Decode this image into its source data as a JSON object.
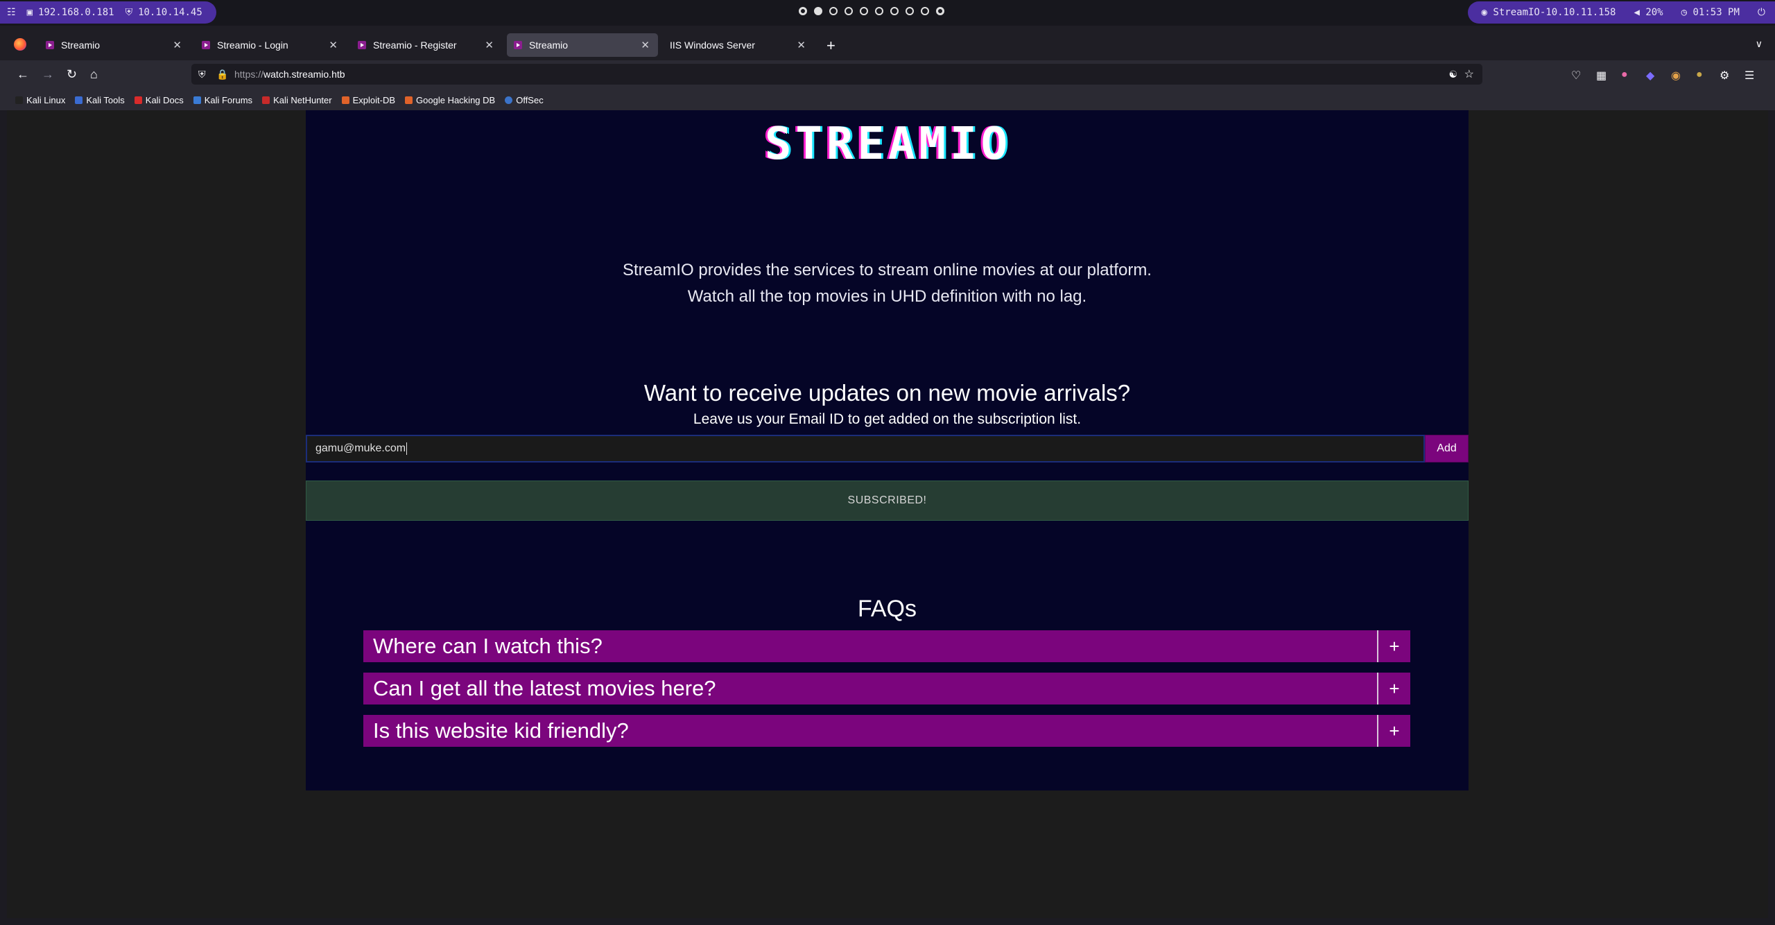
{
  "system": {
    "ip1": "192.168.0.181",
    "ip2": "10.10.14.45",
    "machine": "StreamIO-10.10.11.158",
    "volume": "20%",
    "clock": "01:53 PM"
  },
  "tabs": [
    {
      "label": "Streamio",
      "active": false
    },
    {
      "label": "Streamio - Login",
      "active": false
    },
    {
      "label": "Streamio - Register",
      "active": false
    },
    {
      "label": "Streamio",
      "active": true
    },
    {
      "label": "IIS Windows Server",
      "active": false
    }
  ],
  "address": {
    "prefix": "https://",
    "host": "watch.streamio.htb"
  },
  "bookmarks": [
    {
      "label": "Kali Linux",
      "color": "#222222"
    },
    {
      "label": "Kali Tools",
      "color": "#3a6bd1"
    },
    {
      "label": "Kali Docs",
      "color": "#d92b2b"
    },
    {
      "label": "Kali Forums",
      "color": "#3a7bd5"
    },
    {
      "label": "Kali NetHunter",
      "color": "#c72a2a"
    },
    {
      "label": "Exploit-DB",
      "color": "#e0632a"
    },
    {
      "label": "Google Hacking DB",
      "color": "#e0632a"
    },
    {
      "label": "OffSec",
      "color": "#3b73c9"
    }
  ],
  "page": {
    "logo": "STREAMIO",
    "tagline1": "StreamIO provides the services to stream online movies at our platform.",
    "tagline2": "Watch all the top movies in UHD definition with no lag.",
    "updates_heading": "Want to receive updates on new movie arrivals?",
    "updates_sub": "Leave us your Email ID to get added on the subscription list.",
    "email_value": "gamu@muke.com",
    "add_label": "Add",
    "alert": "SUBSCRIBED!",
    "faq_title": "FAQs",
    "faqs": [
      {
        "q": "Where can I watch this?",
        "icon": "+"
      },
      {
        "q": "Can I get all the latest movies here?",
        "icon": "+"
      },
      {
        "q": "Is this website kid friendly?",
        "icon": "+"
      }
    ]
  }
}
